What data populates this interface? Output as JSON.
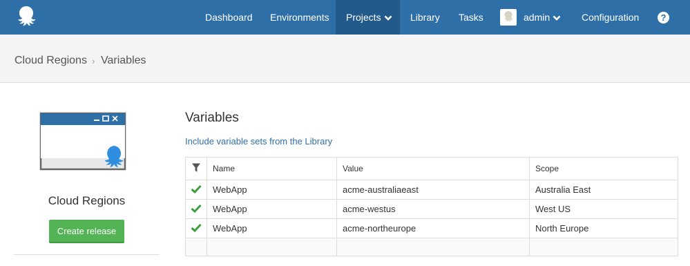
{
  "nav": {
    "items": [
      "Dashboard",
      "Environments",
      "Projects",
      "Library",
      "Tasks"
    ],
    "user": "admin",
    "configuration": "Configuration",
    "help": "?"
  },
  "breadcrumb": {
    "parent": "Cloud Regions",
    "separator": "›",
    "current": "Variables"
  },
  "sidebar": {
    "project_name": "Cloud Regions",
    "create_release": "Create release"
  },
  "main": {
    "title": "Variables",
    "include_link": "Include variable sets from the Library"
  },
  "table": {
    "columns": [
      "Name",
      "Value",
      "Scope"
    ],
    "rows": [
      {
        "name": "WebApp",
        "value": "acme-australiaeast",
        "scope": "Australia East"
      },
      {
        "name": "WebApp",
        "value": "acme-westus",
        "scope": "West US"
      },
      {
        "name": "WebApp",
        "value": "acme-northeurope",
        "scope": "North Europe"
      }
    ]
  },
  "colors": {
    "nav_bg": "#2f6fa8",
    "nav_active": "#225a8c",
    "accent_green": "#52b455",
    "link_blue": "#2f6fa8"
  },
  "icons": {
    "logo": "octopus-logo-icon",
    "filter": "filter-icon",
    "row_status": "check-icon"
  }
}
